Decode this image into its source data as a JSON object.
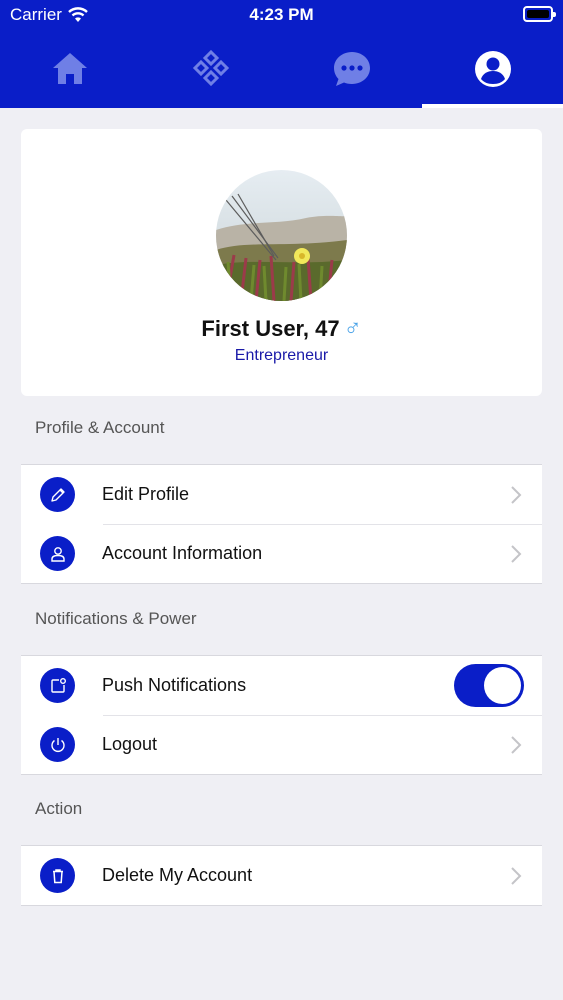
{
  "status_bar": {
    "carrier": "Carrier",
    "time": "4:23 PM"
  },
  "tabs": [
    {
      "icon": "home-icon",
      "active": false
    },
    {
      "icon": "diamond-grid-icon",
      "active": false
    },
    {
      "icon": "chat-icon",
      "active": false
    },
    {
      "icon": "user-circle-icon",
      "active": true
    }
  ],
  "profile": {
    "name_age": "First User, 47",
    "gender_symbol": "♂",
    "occupation": "Entrepreneur"
  },
  "sections": {
    "profile_account": {
      "title": "Profile & Account",
      "items": [
        {
          "label": "Edit Profile",
          "icon": "pencil-icon"
        },
        {
          "label": "Account Information",
          "icon": "person-icon"
        }
      ]
    },
    "notifications_power": {
      "title": "Notifications & Power",
      "items": [
        {
          "label": "Push Notifications",
          "icon": "notification-icon",
          "toggle_on": true
        },
        {
          "label": "Logout",
          "icon": "power-icon"
        }
      ]
    },
    "action": {
      "title": "Action",
      "items": [
        {
          "label": "Delete My Account",
          "icon": "trash-icon"
        }
      ]
    }
  },
  "colors": {
    "brand": "#0a1ec8",
    "background": "#efeff4",
    "gender": "#4aa3e8",
    "occupation": "#1a1aa8"
  }
}
